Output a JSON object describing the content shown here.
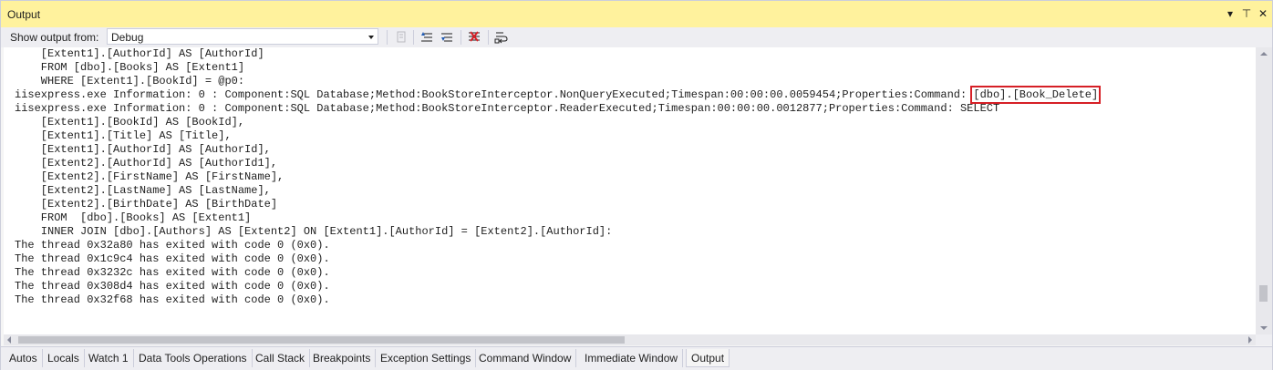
{
  "window": {
    "title": "Output",
    "controls": {
      "dropdown": "▾",
      "pin": "⊤",
      "close": "✕"
    }
  },
  "toolbar": {
    "show_output_label": "Show output from:",
    "source_selected": "Debug",
    "icons": [
      "find-message-in-code-icon",
      "previous-message-icon",
      "next-message-icon",
      "clear-all-icon",
      "toggle-word-wrap-icon"
    ]
  },
  "output": {
    "line_before_highlight": "iisexpress.exe Information: 0 : Component:SQL Database;Method:BookStoreInterceptor.NonQueryExecuted;Timespan:00:00:00.0059454;Properties:Command: ",
    "highlighted_text": "[dbo].[Book_Delete]",
    "lines_top": [
      "    [Extent1].[AuthorId] AS [AuthorId]",
      "    FROM [dbo].[Books] AS [Extent1]",
      "    WHERE [Extent1].[BookId] = @p0:"
    ],
    "lines_bottom": [
      "iisexpress.exe Information: 0 : Component:SQL Database;Method:BookStoreInterceptor.ReaderExecuted;Timespan:00:00:00.0012877;Properties:Command: SELECT",
      "    [Extent1].[BookId] AS [BookId],",
      "    [Extent1].[Title] AS [Title],",
      "    [Extent1].[AuthorId] AS [AuthorId],",
      "    [Extent2].[AuthorId] AS [AuthorId1],",
      "    [Extent2].[FirstName] AS [FirstName],",
      "    [Extent2].[LastName] AS [LastName],",
      "    [Extent2].[BirthDate] AS [BirthDate]",
      "    FROM  [dbo].[Books] AS [Extent1]",
      "    INNER JOIN [dbo].[Authors] AS [Extent2] ON [Extent1].[AuthorId] = [Extent2].[AuthorId]:",
      "The thread 0x32a80 has exited with code 0 (0x0).",
      "The thread 0x1c9c4 has exited with code 0 (0x0).",
      "The thread 0x3232c has exited with code 0 (0x0).",
      "The thread 0x308d4 has exited with code 0 (0x0).",
      "The thread 0x32f68 has exited with code 0 (0x0)."
    ]
  },
  "tabs": [
    {
      "label": "Autos"
    },
    {
      "label": "Locals"
    },
    {
      "label": "Watch 1"
    },
    {
      "label": "Data Tools Operations"
    },
    {
      "label": "Call Stack"
    },
    {
      "label": "Breakpoints"
    },
    {
      "label": "Exception Settings"
    },
    {
      "label": "Command Window"
    },
    {
      "label": "Immediate Window"
    },
    {
      "label": "Output"
    }
  ],
  "active_tab": "Output",
  "colors": {
    "title_bar": "#fff29d",
    "highlight_box": "#d61f26",
    "toolbar_bg": "#eeeef2"
  }
}
